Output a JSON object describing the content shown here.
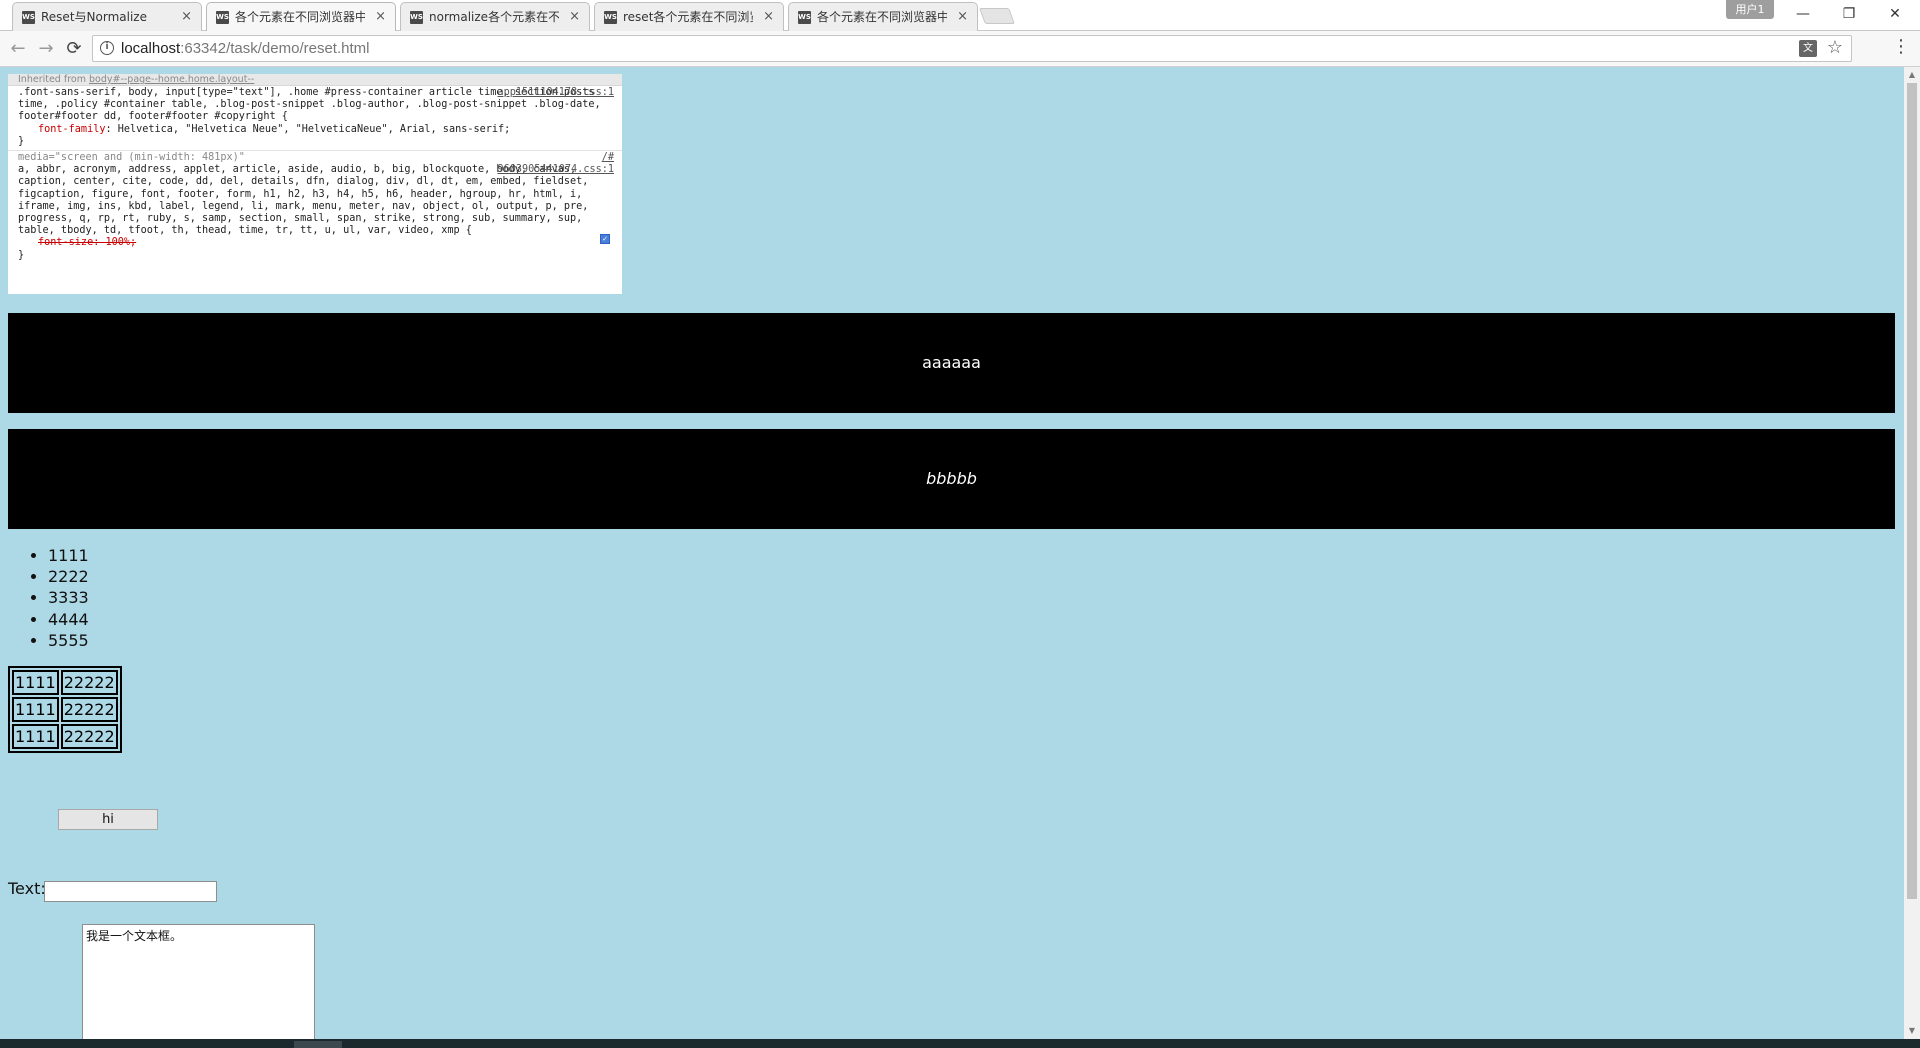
{
  "browser": {
    "tabs": [
      {
        "title": "Reset与Normalize"
      },
      {
        "title": "各个元素在不同浏览器中"
      },
      {
        "title": "normalize各个元素在不"
      },
      {
        "title": "reset各个元素在不同浏览"
      },
      {
        "title": "各个元素在不同浏览器中"
      }
    ],
    "favicon_text": "WS",
    "close_glyph": "×",
    "user_badge": "用户1",
    "window_buttons": {
      "minimize": "—",
      "restore": "❐",
      "close": "✕"
    },
    "url_host": "localhost",
    "url_rest": ":63342/task/demo/reset.html"
  },
  "devtools_snippet": {
    "inherited_label": "Inherited from ",
    "inherited_link": "body#--page--home.home.layout--",
    "rule1": {
      "source": "app1511104178.css:1",
      "selector": ".font-sans-serif, body, input[type=\"text\"], .home #press-container article time, section.posts time, .policy #container table, .blog-post-snippet .blog-author, .blog-post-snippet .blog-date, footer#footer dd, footer#footer #copyright {",
      "prop_name": "font-family",
      "prop_value": ": Helvetica, \"Helvetica Neue\", \"HelveticaNeue\", Arial, sans-serif;",
      "close": "}"
    },
    "rule2": {
      "media": "media=\"screen and (min-width: 481px)\"",
      "source_top": "/#",
      "source": "9603905441074.css:1",
      "selector": "a, abbr, acronym, address, applet, article, aside, audio, b, big, blockquote, body, canvas, caption, center, cite, code, dd, del, details, dfn, dialog, div, dl, dt, em, embed, fieldset, figcaption, figure, font, footer, form, h1, h2, h3, h4, h5, h6, header, hgroup, hr, html, i, iframe, img, ins, kbd, label, legend, li, mark, menu, meter, nav, object, ol, output, p, pre, progress, q, rp, rt, ruby, s, samp, section, small, span, strike, strong, sub, summary, sup, table, tbody, td, tfoot, th, thead, time, tr, tt, u, ul, var, video, xmp {",
      "prop": "font-size: 100%;",
      "close": "}"
    }
  },
  "page": {
    "box1_text": "aaaaaa",
    "box2_text": "bbbbb",
    "list_items": [
      "1111",
      "2222",
      "3333",
      "4444",
      "5555"
    ],
    "table_rows": [
      [
        "1111",
        "22222"
      ],
      [
        "1111",
        "22222"
      ],
      [
        "1111",
        "22222"
      ]
    ],
    "button_label": "hi",
    "text_label": "Text:",
    "text_value": "",
    "textarea_value": "我是一个文本框。"
  },
  "colors": {
    "page_bg": "#add8e6",
    "box_bg": "#000000"
  }
}
